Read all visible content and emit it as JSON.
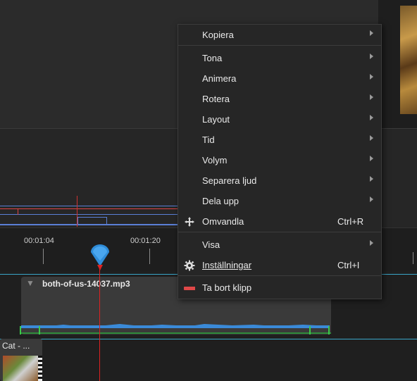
{
  "timeline": {
    "time_labels": [
      "00:01:04",
      "00:01:20"
    ],
    "audio_clip_title": "both-of-us-14037.mp3",
    "second_clip_label": "Cat - ..."
  },
  "context_menu": {
    "items": [
      {
        "label": "Kopiera",
        "submenu": true
      },
      {
        "label": "Tona",
        "submenu": true
      },
      {
        "label": "Animera",
        "submenu": true
      },
      {
        "label": "Rotera",
        "submenu": true
      },
      {
        "label": "Layout",
        "submenu": true
      },
      {
        "label": "Tid",
        "submenu": true
      },
      {
        "label": "Volym",
        "submenu": true
      },
      {
        "label": "Separera ljud",
        "submenu": true
      },
      {
        "label": "Dela upp",
        "submenu": true
      },
      {
        "label": "Omvandla",
        "shortcut": "Ctrl+R",
        "icon": "move-icon"
      },
      {
        "label": "Visa",
        "submenu": true
      },
      {
        "label": "Inställningar",
        "shortcut": "Ctrl+I",
        "icon": "gear-icon"
      },
      {
        "label": "Ta bort klipp",
        "icon": "remove-clip-icon"
      }
    ]
  },
  "colors": {
    "playhead": "#d22222",
    "track_line": "#3aa6c8",
    "waveform": "#3a8ad8",
    "remove_icon": "#e04848"
  }
}
